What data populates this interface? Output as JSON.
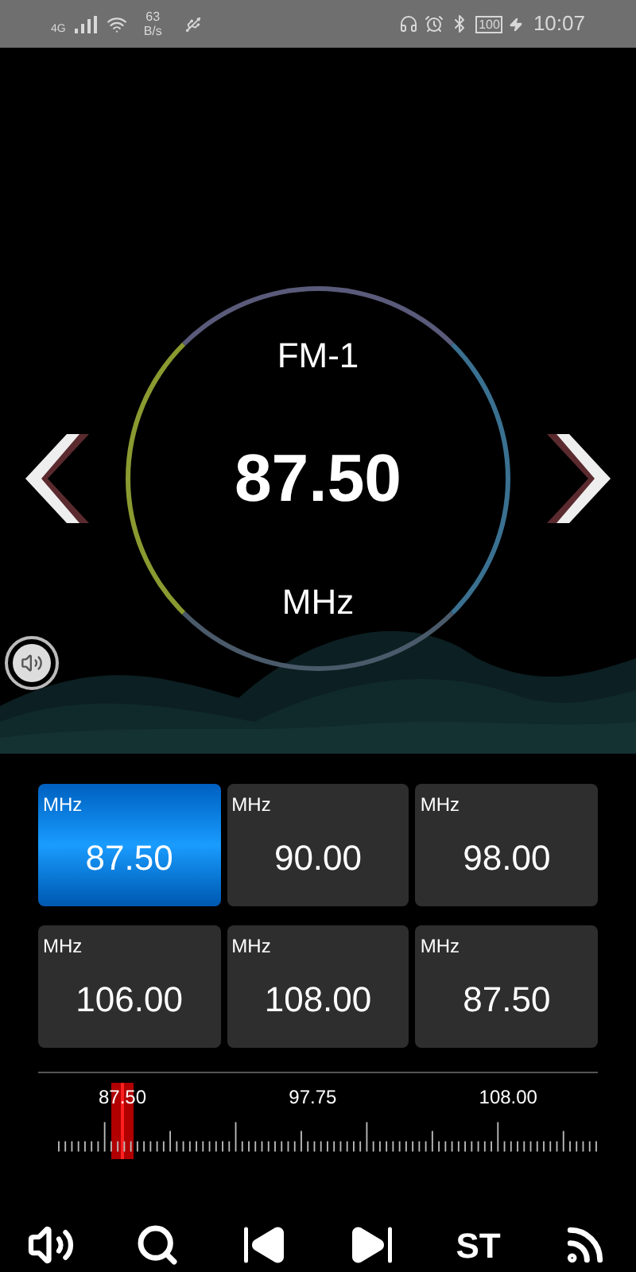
{
  "status_bar": {
    "network": "4G",
    "speed_value": "63",
    "speed_unit": "B/s",
    "battery": "100",
    "time": "10:07"
  },
  "tuner": {
    "band": "FM-1",
    "frequency": "87.50",
    "unit": "MHz"
  },
  "presets": [
    {
      "unit": "MHz",
      "frequency": "87.50",
      "selected": true
    },
    {
      "unit": "MHz",
      "frequency": "90.00",
      "selected": false
    },
    {
      "unit": "MHz",
      "frequency": "98.00",
      "selected": false
    },
    {
      "unit": "MHz",
      "frequency": "106.00",
      "selected": false
    },
    {
      "unit": "MHz",
      "frequency": "108.00",
      "selected": false
    },
    {
      "unit": "MHz",
      "frequency": "87.50",
      "selected": false
    }
  ],
  "scale": {
    "labels": [
      "87.50",
      "97.75",
      "108.00"
    ]
  },
  "toolbar": [
    {
      "kind": "volume"
    },
    {
      "kind": "search"
    },
    {
      "kind": "previous"
    },
    {
      "kind": "next"
    },
    {
      "kind": "text",
      "label": "ST"
    },
    {
      "kind": "signal"
    }
  ]
}
